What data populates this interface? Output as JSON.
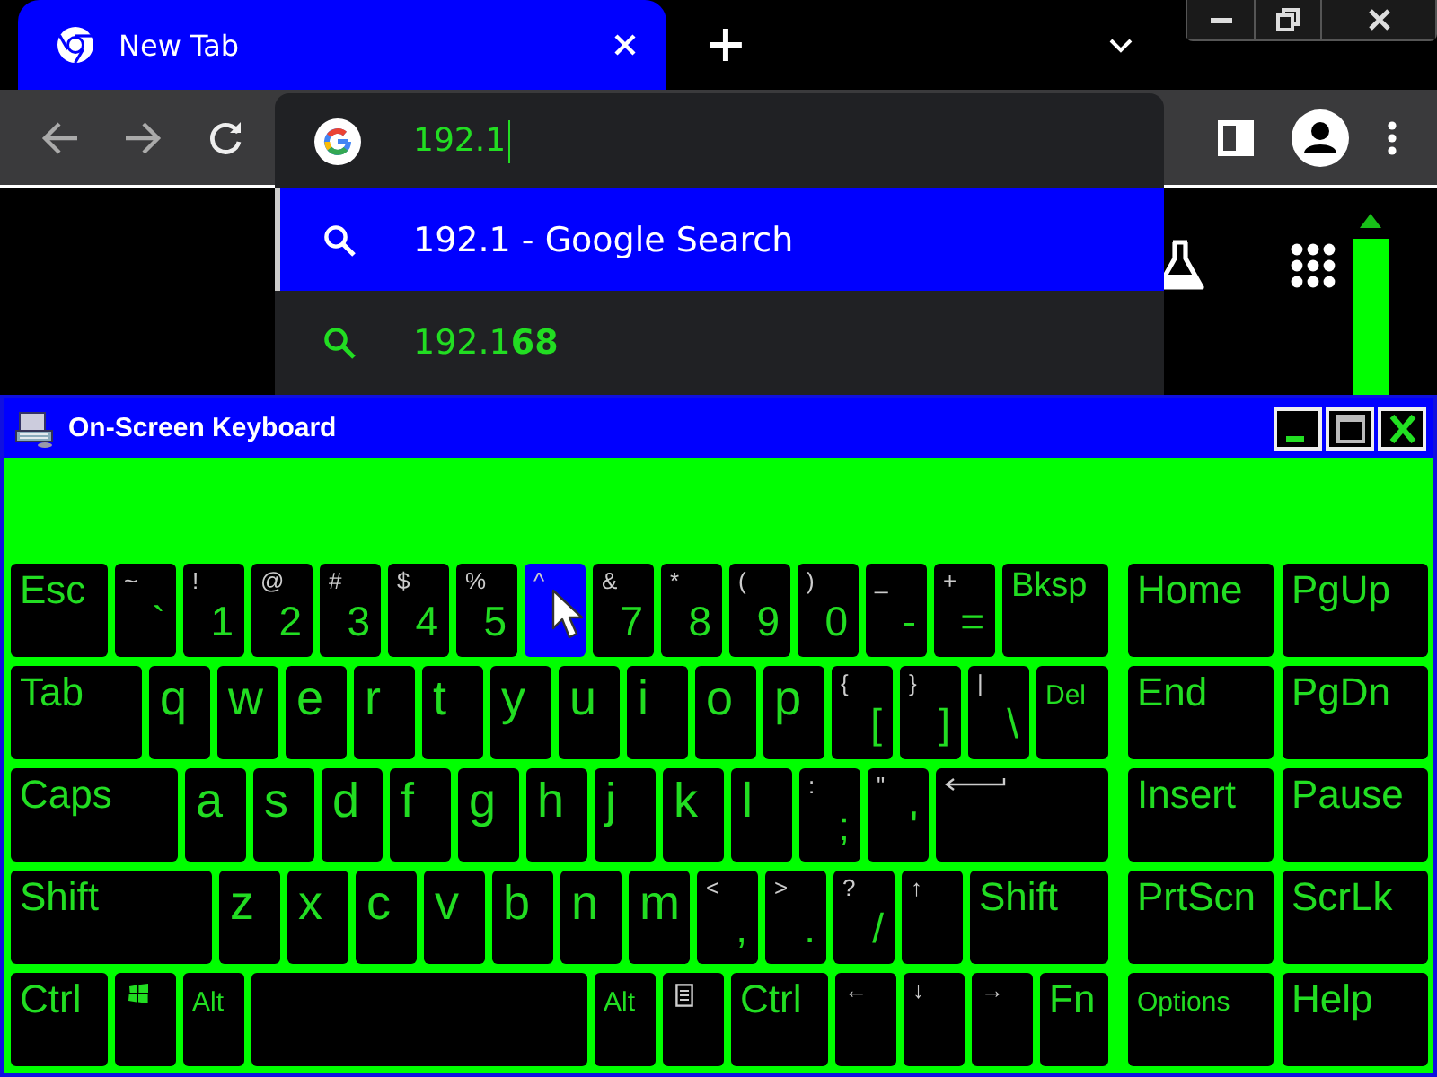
{
  "browser": {
    "tab": {
      "title": "New Tab",
      "selected": true
    },
    "omnibox": {
      "value": "192.1"
    },
    "suggestions": [
      {
        "text": "192.1 - Google Search",
        "selected": true
      },
      {
        "text": "192.1**68**",
        "selected": false
      }
    ]
  },
  "keyboard_window": {
    "title": "On-Screen Keyboard",
    "rows": [
      {
        "keys": [
          {
            "kind": "esc",
            "label": "Esc",
            "hover": false
          },
          {
            "kind": "symbol",
            "shift": "~",
            "base": "`",
            "hover": false
          },
          {
            "kind": "symbol",
            "shift": "!",
            "base": "1",
            "hover": false
          },
          {
            "kind": "symbol",
            "shift": "@",
            "base": "2",
            "hover": false
          },
          {
            "kind": "symbol",
            "shift": "#",
            "base": "3",
            "hover": false
          },
          {
            "kind": "symbol",
            "shift": "$",
            "base": "4",
            "hover": false
          },
          {
            "kind": "symbol",
            "shift": "%",
            "base": "5",
            "hover": false
          },
          {
            "kind": "symbol",
            "shift": "^",
            "hover": true
          },
          {
            "kind": "symbol",
            "shift": "&",
            "base": "7",
            "hover": false
          },
          {
            "kind": "symbol",
            "shift": "*",
            "base": "8",
            "hover": false
          },
          {
            "kind": "symbol",
            "shift": "(",
            "base": "9",
            "hover": false
          },
          {
            "kind": "symbol",
            "shift": ")",
            "base": "0",
            "hover": false
          },
          {
            "kind": "symbol",
            "shift": "_",
            "base": "-",
            "hover": false
          },
          {
            "kind": "symbol",
            "shift": "+",
            "base": "=",
            "hover": false
          },
          {
            "kind": "bksp",
            "label": "Bksp",
            "hover": false
          }
        ],
        "side_keys": [
          {
            "kind": "nav",
            "label": "Home",
            "hover": false
          },
          {
            "kind": "nav",
            "label": "PgUp",
            "hover": false
          }
        ]
      },
      {
        "keys": [
          {
            "kind": "tab",
            "label": "Tab",
            "hover": false
          },
          {
            "kind": "letter",
            "label": "q",
            "hover": false
          },
          {
            "kind": "letter",
            "label": "w",
            "hover": false
          },
          {
            "kind": "letter",
            "label": "e",
            "hover": false
          },
          {
            "kind": "letter",
            "label": "r",
            "hover": false
          },
          {
            "kind": "letter",
            "label": "t",
            "hover": false
          },
          {
            "kind": "letter",
            "label": "y",
            "hover": false
          },
          {
            "kind": "letter",
            "label": "u",
            "hover": false
          },
          {
            "kind": "letter",
            "label": "i",
            "hover": false
          },
          {
            "kind": "letter",
            "label": "o",
            "hover": false
          },
          {
            "kind": "letter",
            "label": "p",
            "hover": false
          },
          {
            "kind": "symbol",
            "shift": "{",
            "base": "[",
            "hover": false
          },
          {
            "kind": "symbol",
            "shift": "}",
            "base": "]",
            "hover": false
          },
          {
            "kind": "symbol",
            "shift": "|",
            "base": "\\",
            "hover": false
          },
          {
            "kind": "del",
            "label": "Del",
            "hover": false
          }
        ],
        "side_keys": [
          {
            "kind": "nav",
            "label": "End",
            "hover": false
          },
          {
            "kind": "nav",
            "label": "PgDn",
            "hover": false
          }
        ]
      },
      {
        "keys": [
          {
            "kind": "caps",
            "label": "Caps",
            "hover": false
          },
          {
            "kind": "letter",
            "label": "a",
            "hover": false
          },
          {
            "kind": "letter",
            "label": "s",
            "hover": false
          },
          {
            "kind": "letter",
            "label": "d",
            "hover": false
          },
          {
            "kind": "letter",
            "label": "f",
            "hover": false
          },
          {
            "kind": "letter",
            "label": "g",
            "hover": false
          },
          {
            "kind": "letter",
            "label": "h",
            "hover": false
          },
          {
            "kind": "letter",
            "label": "j",
            "hover": false
          },
          {
            "kind": "letter",
            "label": "k",
            "hover": false
          },
          {
            "kind": "letter",
            "label": "l",
            "hover": false
          },
          {
            "kind": "symbol",
            "shift": ":",
            "base": ";",
            "hover": false
          },
          {
            "kind": "symbol",
            "shift": "\"",
            "base": "'",
            "hover": false
          },
          {
            "kind": "enter",
            "hover": false
          }
        ],
        "side_keys": [
          {
            "kind": "nav",
            "label": "Insert",
            "hover": false
          },
          {
            "kind": "nav",
            "label": "Pause",
            "hover": false
          }
        ]
      },
      {
        "keys": [
          {
            "kind": "lshift",
            "label": "Shift",
            "hover": false
          },
          {
            "kind": "letter",
            "label": "z",
            "hover": false
          },
          {
            "kind": "letter",
            "label": "x",
            "hover": false
          },
          {
            "kind": "letter",
            "label": "c",
            "hover": false
          },
          {
            "kind": "letter",
            "label": "v",
            "hover": false
          },
          {
            "kind": "letter",
            "label": "b",
            "hover": false
          },
          {
            "kind": "letter",
            "label": "n",
            "hover": false
          },
          {
            "kind": "letter",
            "label": "m",
            "hover": false
          },
          {
            "kind": "symbol",
            "shift": "<",
            "base": ",",
            "hover": false
          },
          {
            "kind": "symbol",
            "shift": ">",
            "base": ".",
            "hover": false
          },
          {
            "kind": "symbol",
            "shift": "?",
            "base": "/",
            "hover": false
          },
          {
            "kind": "arrow",
            "label": "↑",
            "hover": false
          },
          {
            "kind": "rshift",
            "label": "Shift",
            "hover": false
          }
        ],
        "side_keys": [
          {
            "kind": "nav",
            "label": "PrtScn",
            "hover": false
          },
          {
            "kind": "nav",
            "label": "ScrLk",
            "hover": false
          }
        ]
      },
      {
        "keys": [
          {
            "kind": "ctrl",
            "label": "Ctrl",
            "hover": false
          },
          {
            "kind": "win",
            "hover": false
          },
          {
            "kind": "alt",
            "label": "Alt",
            "hover": false
          },
          {
            "kind": "space",
            "hover": false
          },
          {
            "kind": "alt",
            "label": "Alt",
            "hover": false
          },
          {
            "kind": "menu",
            "hover": false
          },
          {
            "kind": "ctrl",
            "label": "Ctrl",
            "hover": false
          },
          {
            "kind": "arrow",
            "label": "←",
            "hover": false
          },
          {
            "kind": "arrow",
            "label": "↓",
            "hover": false
          },
          {
            "kind": "arrow",
            "label": "→",
            "hover": false
          },
          {
            "kind": "fn",
            "label": "Fn",
            "hover": false
          }
        ],
        "side_keys": [
          {
            "kind": "navsmall",
            "label": "Options",
            "hover": false
          },
          {
            "kind": "nav",
            "label": "Help",
            "hover": false
          }
        ]
      }
    ]
  }
}
